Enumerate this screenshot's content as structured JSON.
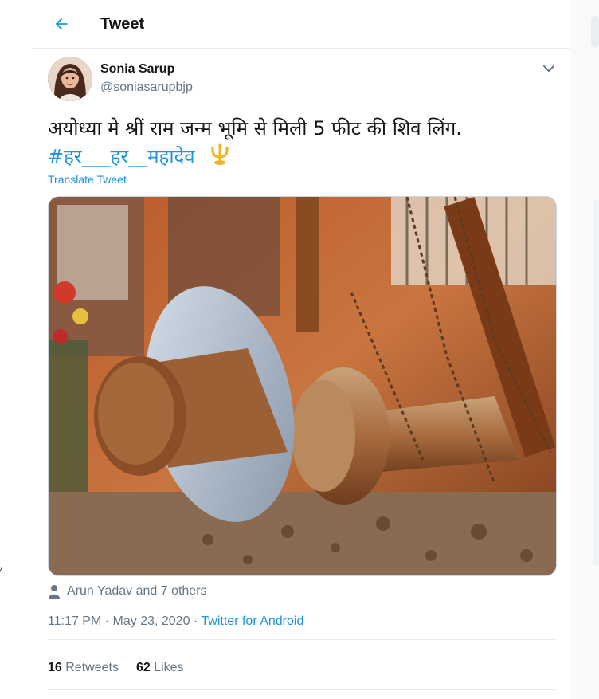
{
  "header": {
    "title": "Tweet",
    "back_icon": "arrow-left-icon"
  },
  "author": {
    "display_name": "Sonia Sarup",
    "handle": "@soniasarupbjp"
  },
  "tweet": {
    "text": "अयोध्या मे श्रीं राम जन्म भूमि से मिली 5 फीट की शिव लिंग.",
    "hashtag": "#हर___हर__महादेव",
    "emoji": "trident-emoji",
    "translate_label": "Translate Tweet"
  },
  "liked_by": "Arun Yadav and 7 others",
  "meta": {
    "time": "11:17 PM",
    "separator": " · ",
    "date": "May 23, 2020",
    "source": "Twitter for Android"
  },
  "stats": {
    "retweets_count": "16",
    "retweets_label": "Retweets",
    "likes_count": "62",
    "likes_label": "Likes"
  },
  "colors": {
    "accent": "#1b95e0",
    "text": "#14171a",
    "muted": "#657786",
    "border": "#e6ecf0"
  }
}
